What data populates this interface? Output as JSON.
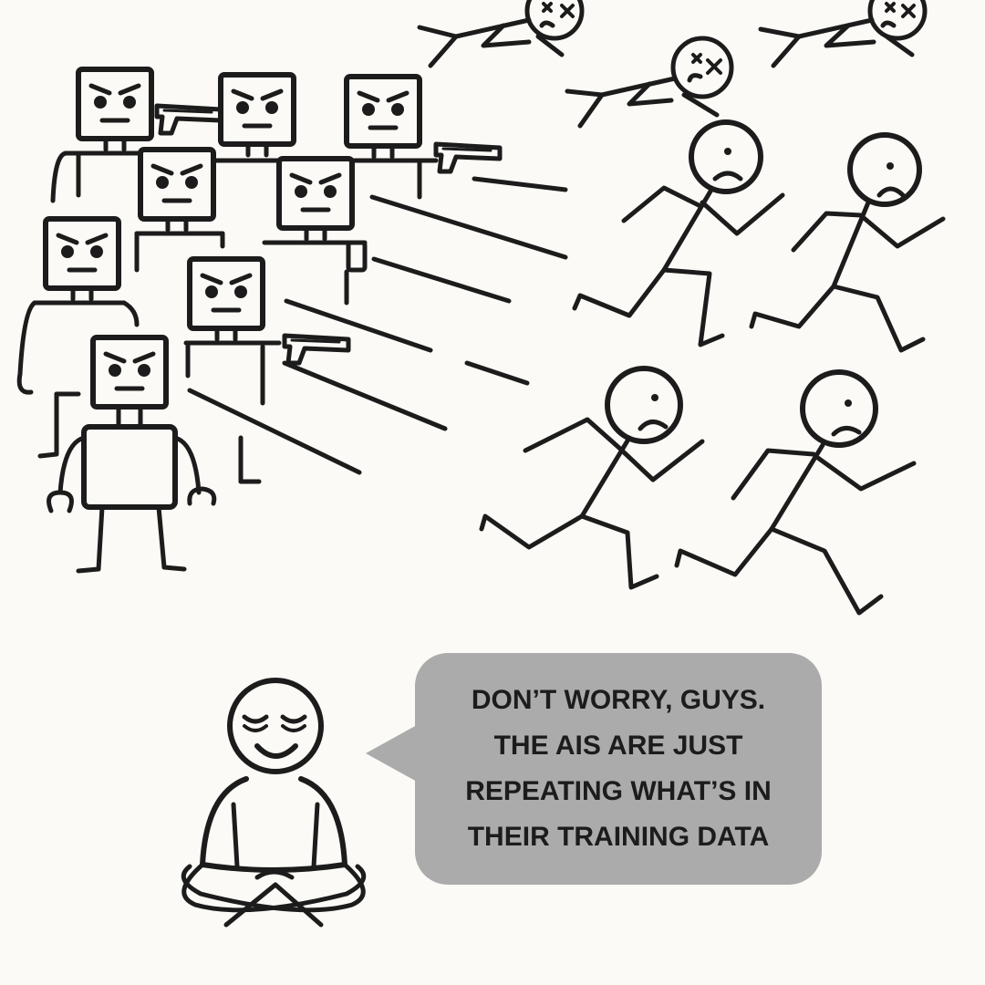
{
  "speech_bubble": {
    "lines": [
      "DON’T WORRY, GUYS.",
      "THE AIS ARE JUST",
      "REPEATING WHAT’S IN",
      "THEIR TRAINING DATA"
    ],
    "background_color": "#ababab"
  },
  "colors": {
    "ink": "#1c1c1c",
    "paper": "#fbfaf6"
  }
}
